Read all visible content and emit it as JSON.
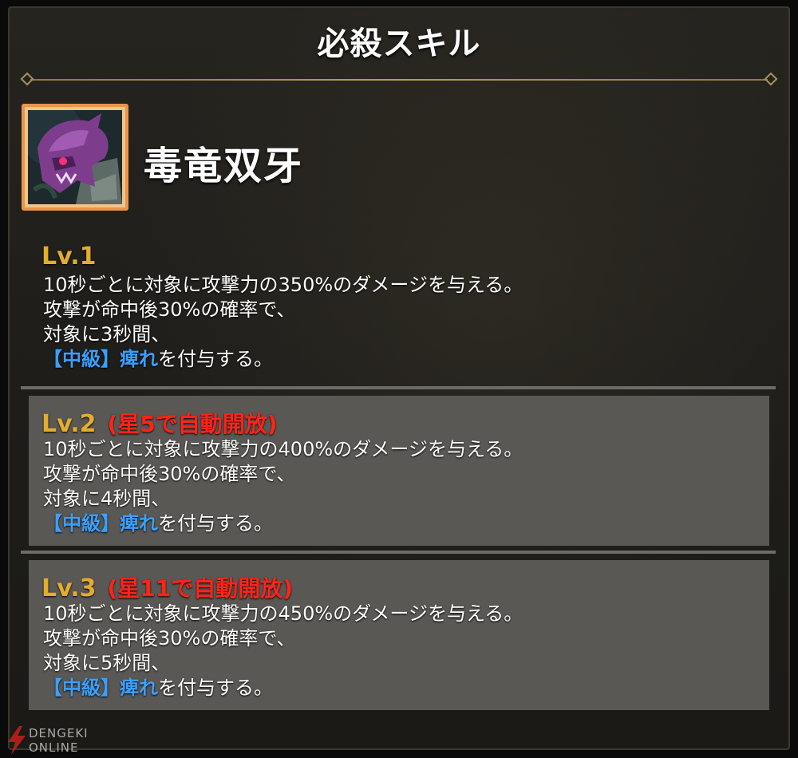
{
  "header": {
    "title": "必殺スキル"
  },
  "skill": {
    "icon": "poison-dragon-icon",
    "name": "毒竜双牙"
  },
  "levels": [
    {
      "label": "Lv.1",
      "unlock": "",
      "line1": "10秒ごとに対象に攻撃力の350%のダメージを与える。",
      "line2": "攻撃が命中後30%の確率で、",
      "line3": "対象に3秒間、",
      "effect_grade": "【中級】",
      "effect_name": "痺れ",
      "effect_suffix": "を付与する。"
    },
    {
      "label": "Lv.2",
      "unlock": "(星5で自動開放)",
      "line1": "10秒ごとに対象に攻撃力の400%のダメージを与える。",
      "line2": "攻撃が命中後30%の確率で、",
      "line3": "対象に4秒間、",
      "effect_grade": "【中級】",
      "effect_name": "痺れ",
      "effect_suffix": "を付与する。"
    },
    {
      "label": "Lv.3",
      "unlock": "(星11で自動開放)",
      "line1": "10秒ごとに対象に攻撃力の450%のダメージを与える。",
      "line2": "攻撃が命中後30%の確率で、",
      "line3": "対象に5秒間、",
      "effect_grade": "【中級】",
      "effect_name": "痺れ",
      "effect_suffix": "を付与する。"
    }
  ],
  "colors": {
    "level_label": "#e3ad2e",
    "unlock_text": "#ff2418",
    "keyword": "#3aa0ff",
    "icon_frame": "#e8954a"
  },
  "watermark": {
    "line1": "DENGEKI",
    "line2": "ONLINE"
  }
}
